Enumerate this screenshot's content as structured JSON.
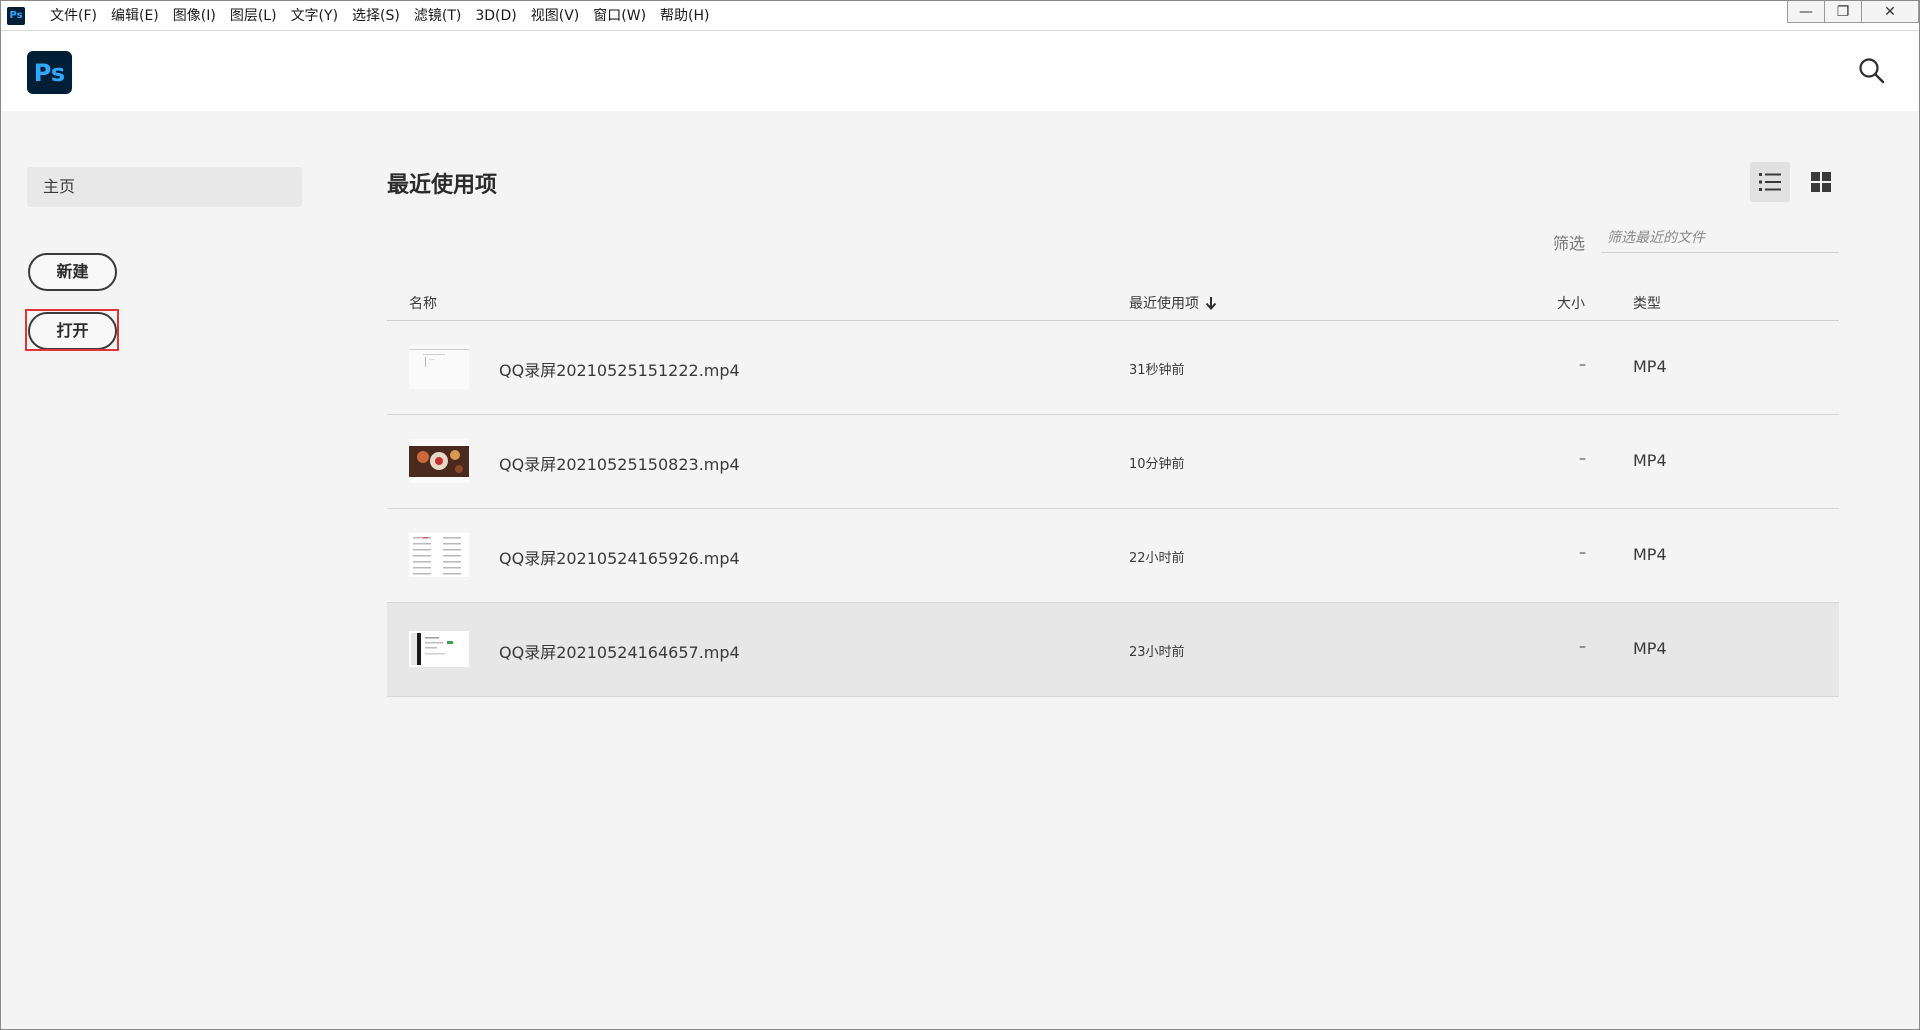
{
  "menubar": {
    "app_icon": "Ps",
    "items": [
      "文件(F)",
      "编辑(E)",
      "图像(I)",
      "图层(L)",
      "文字(Y)",
      "选择(S)",
      "滤镜(T)",
      "3D(D)",
      "视图(V)",
      "窗口(W)",
      "帮助(H)"
    ],
    "controls": {
      "minimize": "—",
      "restore": "❐",
      "close": "✕"
    }
  },
  "header": {
    "logo": "Ps",
    "search_icon": "search-icon"
  },
  "sidebar": {
    "home_label": "主页",
    "new_label": "新建",
    "open_label": "打开",
    "highlight_color": "#e03535"
  },
  "main": {
    "title": "最近使用项",
    "view_toggle": {
      "list_icon": "list-view-icon",
      "grid_icon": "grid-view-icon",
      "active": "list"
    },
    "filter": {
      "label": "筛选",
      "placeholder": "筛选最近的文件",
      "value": ""
    },
    "table": {
      "columns": {
        "name": "名称",
        "recent": "最近使用项",
        "size": "大小",
        "type": "类型"
      },
      "sort_icon": "arrow-down-icon",
      "rows": [
        {
          "name": "QQ录屏20210525151222.mp4",
          "time": "31秒钟前",
          "size": "–",
          "type": "MP4",
          "thumb": "blank-doc",
          "selected": false
        },
        {
          "name": "QQ录屏20210525150823.mp4",
          "time": "10分钟前",
          "size": "–",
          "type": "MP4",
          "thumb": "photo",
          "selected": false
        },
        {
          "name": "QQ录屏20210524165926.mp4",
          "time": "22小时前",
          "size": "–",
          "type": "MP4",
          "thumb": "list-doc",
          "selected": false
        },
        {
          "name": "QQ录屏20210524164657.mp4",
          "time": "23小时前",
          "size": "–",
          "type": "MP4",
          "thumb": "ui-screen",
          "selected": true
        }
      ]
    }
  }
}
